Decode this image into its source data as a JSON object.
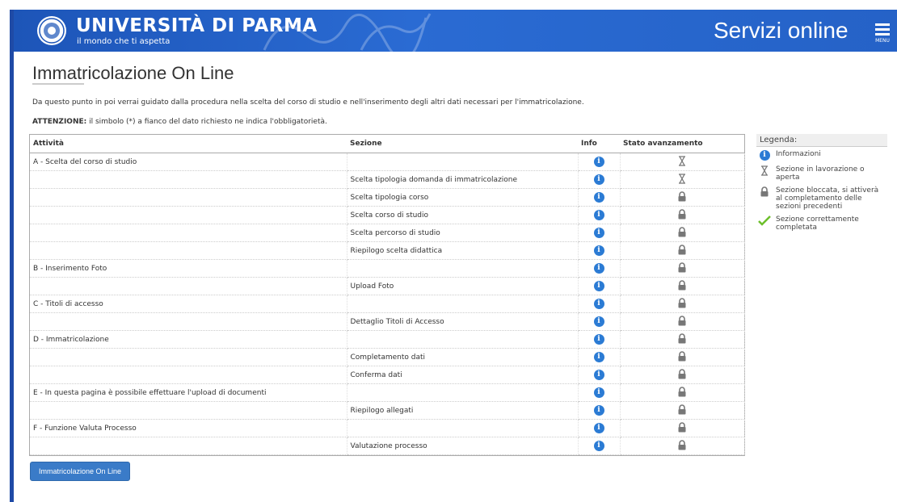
{
  "header": {
    "university": "UNIVERSITÀ DI PARMA",
    "tagline": "il mondo che ti aspetta",
    "services": "Servizi online",
    "menu_label": "MENU"
  },
  "page": {
    "title": "Immatricolazione On Line",
    "intro": "Da questo punto in poi verrai guidato dalla procedura nella scelta del corso di studio e nell'inserimento degli altri dati necessari per l'immatricolazione.",
    "warning_bold": "ATTENZIONE:",
    "warning_text": " il simbolo (*) a fianco del dato richiesto ne indica l'obbligatorietà."
  },
  "table": {
    "headers": [
      "Attività",
      "Sezione",
      "Info",
      "Stato avanzamento"
    ],
    "rows": [
      {
        "activity": "A - Scelta del corso di studio",
        "section": "",
        "status": "in-progress"
      },
      {
        "activity": "",
        "section": "Scelta tipologia domanda di immatricolazione",
        "status": "in-progress"
      },
      {
        "activity": "",
        "section": "Scelta tipologia corso",
        "status": "locked"
      },
      {
        "activity": "",
        "section": "Scelta corso di studio",
        "status": "locked"
      },
      {
        "activity": "",
        "section": "Scelta percorso di studio",
        "status": "locked"
      },
      {
        "activity": "",
        "section": "Riepilogo scelta didattica",
        "status": "locked"
      },
      {
        "activity": "B - Inserimento Foto",
        "section": "",
        "status": "locked"
      },
      {
        "activity": "",
        "section": "Upload Foto",
        "status": "locked"
      },
      {
        "activity": "C - Titoli di accesso",
        "section": "",
        "status": "locked"
      },
      {
        "activity": "",
        "section": "Dettaglio Titoli di Accesso",
        "status": "locked"
      },
      {
        "activity": "D - Immatricolazione",
        "section": "",
        "status": "locked"
      },
      {
        "activity": "",
        "section": "Completamento dati",
        "status": "locked"
      },
      {
        "activity": "",
        "section": "Conferma dati",
        "status": "locked"
      },
      {
        "activity": "E - In questa pagina è possibile effettuare l'upload di documenti",
        "section": "",
        "status": "locked"
      },
      {
        "activity": "",
        "section": "Riepilogo allegati",
        "status": "locked"
      },
      {
        "activity": "F - Funzione Valuta Processo",
        "section": "",
        "status": "locked"
      },
      {
        "activity": "",
        "section": "Valutazione processo",
        "status": "locked"
      }
    ]
  },
  "legend": {
    "title": "Legenda:",
    "items": [
      {
        "icon": "info-icon",
        "label": "Informazioni"
      },
      {
        "icon": "hourglass-icon",
        "label": "Sezione in lavorazione o aperta"
      },
      {
        "icon": "lock-icon",
        "label": "Sezione bloccata, si attiverà al completamento delle sezioni precedenti"
      },
      {
        "icon": "checkmark-icon",
        "label": "Sezione correttamente completata"
      }
    ]
  },
  "button": {
    "label": "Immatricolazione On Line"
  },
  "colors": {
    "header_blue": "#2562c7",
    "info_blue": "#2b7bd4",
    "button_blue": "#3a7bc8"
  }
}
